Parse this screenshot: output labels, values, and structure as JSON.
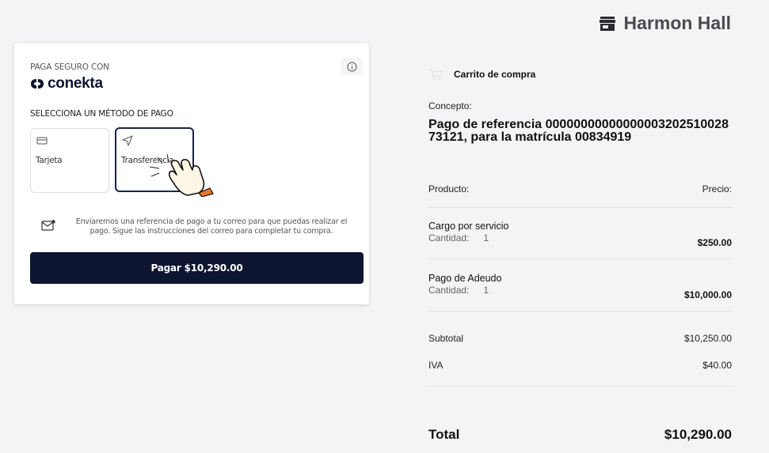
{
  "header": {
    "brand_name": "Harmon Hall",
    "brand_icon": "store-icon"
  },
  "payment": {
    "secure_label": "PAGA SEGURO CON",
    "logo_text": "conekta",
    "info_icon": "info-icon",
    "method_title": "SELECCIONA UN MÉTODO DE PAGO",
    "methods": [
      {
        "label": "Tarjeta",
        "icon": "credit-card-icon",
        "selected": false
      },
      {
        "label": "Transferencia",
        "icon": "send-icon",
        "selected": true
      }
    ],
    "notice_text": "Enviaremos una referencia de pago a tu correo para que puedas realizar el pago. Sigue las instrucciones del correo para completar tu compra.",
    "pay_button_label": "Pagar $10,290.00",
    "accent_color": "#0d1530"
  },
  "cart": {
    "title": "Carrito de compra",
    "concept_label": "Concepto:",
    "concept_value": "Pago de referencia 0000000000000000320251002873121, para la matrícula 00834919",
    "product_header": "Producto:",
    "price_header": "Precio:",
    "items": [
      {
        "name": "Cargo por servicio",
        "qty_label": "Cantidad:",
        "qty": "1",
        "price": "$250.00"
      },
      {
        "name": "Pago de Adeudo",
        "qty_label": "Cantidad:",
        "qty": "1",
        "price": "$10,000.00"
      }
    ],
    "subtotal_label": "Subtotal",
    "subtotal_value": "$10,250.00",
    "iva_label": "IVA",
    "iva_value": "$40.00",
    "total_label": "Total",
    "total_value": "$10,290.00"
  }
}
